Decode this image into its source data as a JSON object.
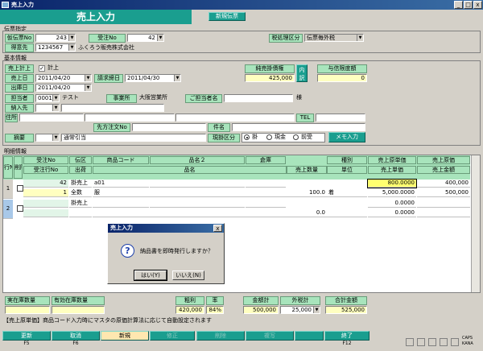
{
  "window": {
    "title": "売上入力",
    "btn_min": "_",
    "btn_max": "□",
    "btn_close": "x"
  },
  "banner": {
    "title": "売上入力",
    "new_slip": "新規伝票"
  },
  "slip": {
    "section": "伝票指定",
    "tanka_label": "仮伝票No",
    "tanka_value": "243",
    "juchu_label": "受注No",
    "juchu_value": "42",
    "tax_label": "税処理区分",
    "tax_value": "伝票毎外税",
    "tokui_label": "得意先",
    "tokui_code": "1234567",
    "tokui_name": "ふくろう販売株式会社"
  },
  "basic": {
    "section": "基本情報",
    "keijo_label": "売上計上",
    "keijo_check": "計上",
    "uriage_label": "売上日",
    "uriage_value": "2011/04/20",
    "seikyu_label": "請求締日",
    "seikyu_value": "2011/04/30",
    "shukka_label": "出庫日",
    "shukka_value": "2011/04/20",
    "tanto_label": "担当者",
    "tanto_code": "0001",
    "tanto_name": "テスト",
    "jigyo_label": "事業所",
    "jigyo_value": "大阪営業所",
    "gotanto_label": "ご担当者名",
    "sama": "様",
    "nonyu_label": "納入先",
    "jusho_label": "住所",
    "tel_label": "TEL",
    "sakichumon_label": "先方注文No",
    "kenmei_label": "件名",
    "tekiyo_label": "摘要",
    "tekiyo_value": "通常引当",
    "genkin_label": "現掛区分",
    "radio1": "掛",
    "radio2": "現金",
    "radio3": "前受",
    "memo_btn": "メモ入力",
    "junuri_label": "純売掛債権",
    "junuri_value": "425,000",
    "uchiwake": "内訳",
    "yoshin_label": "与信限度額",
    "yoshin_value": "0"
  },
  "detail": {
    "section": "明細情報",
    "headers_top": [
      "行No",
      "削除",
      "受注No",
      "伝区",
      "商品コード",
      "品名２",
      "倉庫",
      "種別",
      "売上原単価",
      "売上原価"
    ],
    "headers_bot": [
      "受注行No",
      "出荷",
      "品名",
      "売上数量",
      "単位",
      "売上単価",
      "売上金額"
    ],
    "rows": [
      {
        "no": "1",
        "juchu": "42",
        "denku": "掛売上",
        "code": "a01",
        "qty": "",
        "cost_unit": "800.0000",
        "cost": "400,000",
        "gyo": "1",
        "shukka": "全数",
        "name": "服",
        "qty2": "100.0",
        "unit": "着",
        "price": "5,000.0000",
        "amount": "500,000"
      },
      {
        "no": "2",
        "juchu": "",
        "denku": "掛売上",
        "code": "",
        "qty": "",
        "cost_unit": "0.0000",
        "cost": "",
        "gyo": "",
        "shukka": "",
        "name": "",
        "qty2": "0.0",
        "unit": "",
        "price": "0.0000",
        "amount": ""
      }
    ]
  },
  "dialog": {
    "title": "売上入力",
    "close": "x",
    "message": "納品書を即時発行しますか？",
    "yes": "はい(Y)",
    "no": "いいえ(N)",
    "icon": "?"
  },
  "footer": {
    "zaiko_label": "実在庫数量",
    "yuko_label": "有効在庫数量",
    "arari_label": "粗利",
    "arari_value": "420,000",
    "ritsu_label": "率",
    "ritsu_value": "84%",
    "kingaku_label": "金額計",
    "kingaku_value": "500,000",
    "sotozei_label": "外税計",
    "sotozei_value": "25,000",
    "gokei_label": "合計金額",
    "gokei_value": "525,000"
  },
  "status": {
    "message": "【売上原単価】商品コード入力時にマスタの原価計算法に応じて自動設定されます"
  },
  "fkeys": [
    {
      "label": "更新",
      "key": "F5"
    },
    {
      "label": "取消",
      "key": "F6"
    },
    {
      "label": "新規",
      "key": ""
    },
    {
      "label": "修正",
      "key": ""
    },
    {
      "label": "削除",
      "key": ""
    },
    {
      "label": "複写",
      "key": ""
    },
    {
      "label": "",
      "key": ""
    },
    {
      "label": "終了",
      "key": "F12"
    }
  ],
  "tray": {
    "caps": "CAPS",
    "kana": "KANA"
  }
}
